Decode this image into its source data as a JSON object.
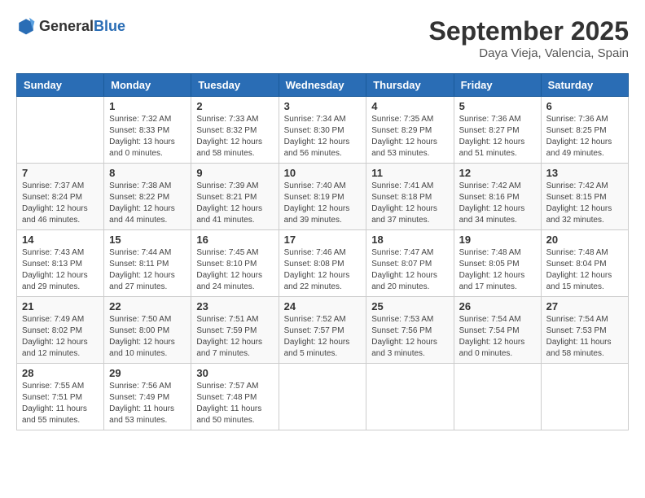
{
  "header": {
    "logo_general": "General",
    "logo_blue": "Blue",
    "month": "September 2025",
    "location": "Daya Vieja, Valencia, Spain"
  },
  "days_of_week": [
    "Sunday",
    "Monday",
    "Tuesday",
    "Wednesday",
    "Thursday",
    "Friday",
    "Saturday"
  ],
  "weeks": [
    [
      {
        "day": "",
        "sunrise": "",
        "sunset": "",
        "daylight": ""
      },
      {
        "day": "1",
        "sunrise": "Sunrise: 7:32 AM",
        "sunset": "Sunset: 8:33 PM",
        "daylight": "Daylight: 13 hours and 0 minutes."
      },
      {
        "day": "2",
        "sunrise": "Sunrise: 7:33 AM",
        "sunset": "Sunset: 8:32 PM",
        "daylight": "Daylight: 12 hours and 58 minutes."
      },
      {
        "day": "3",
        "sunrise": "Sunrise: 7:34 AM",
        "sunset": "Sunset: 8:30 PM",
        "daylight": "Daylight: 12 hours and 56 minutes."
      },
      {
        "day": "4",
        "sunrise": "Sunrise: 7:35 AM",
        "sunset": "Sunset: 8:29 PM",
        "daylight": "Daylight: 12 hours and 53 minutes."
      },
      {
        "day": "5",
        "sunrise": "Sunrise: 7:36 AM",
        "sunset": "Sunset: 8:27 PM",
        "daylight": "Daylight: 12 hours and 51 minutes."
      },
      {
        "day": "6",
        "sunrise": "Sunrise: 7:36 AM",
        "sunset": "Sunset: 8:25 PM",
        "daylight": "Daylight: 12 hours and 49 minutes."
      }
    ],
    [
      {
        "day": "7",
        "sunrise": "Sunrise: 7:37 AM",
        "sunset": "Sunset: 8:24 PM",
        "daylight": "Daylight: 12 hours and 46 minutes."
      },
      {
        "day": "8",
        "sunrise": "Sunrise: 7:38 AM",
        "sunset": "Sunset: 8:22 PM",
        "daylight": "Daylight: 12 hours and 44 minutes."
      },
      {
        "day": "9",
        "sunrise": "Sunrise: 7:39 AM",
        "sunset": "Sunset: 8:21 PM",
        "daylight": "Daylight: 12 hours and 41 minutes."
      },
      {
        "day": "10",
        "sunrise": "Sunrise: 7:40 AM",
        "sunset": "Sunset: 8:19 PM",
        "daylight": "Daylight: 12 hours and 39 minutes."
      },
      {
        "day": "11",
        "sunrise": "Sunrise: 7:41 AM",
        "sunset": "Sunset: 8:18 PM",
        "daylight": "Daylight: 12 hours and 37 minutes."
      },
      {
        "day": "12",
        "sunrise": "Sunrise: 7:42 AM",
        "sunset": "Sunset: 8:16 PM",
        "daylight": "Daylight: 12 hours and 34 minutes."
      },
      {
        "day": "13",
        "sunrise": "Sunrise: 7:42 AM",
        "sunset": "Sunset: 8:15 PM",
        "daylight": "Daylight: 12 hours and 32 minutes."
      }
    ],
    [
      {
        "day": "14",
        "sunrise": "Sunrise: 7:43 AM",
        "sunset": "Sunset: 8:13 PM",
        "daylight": "Daylight: 12 hours and 29 minutes."
      },
      {
        "day": "15",
        "sunrise": "Sunrise: 7:44 AM",
        "sunset": "Sunset: 8:11 PM",
        "daylight": "Daylight: 12 hours and 27 minutes."
      },
      {
        "day": "16",
        "sunrise": "Sunrise: 7:45 AM",
        "sunset": "Sunset: 8:10 PM",
        "daylight": "Daylight: 12 hours and 24 minutes."
      },
      {
        "day": "17",
        "sunrise": "Sunrise: 7:46 AM",
        "sunset": "Sunset: 8:08 PM",
        "daylight": "Daylight: 12 hours and 22 minutes."
      },
      {
        "day": "18",
        "sunrise": "Sunrise: 7:47 AM",
        "sunset": "Sunset: 8:07 PM",
        "daylight": "Daylight: 12 hours and 20 minutes."
      },
      {
        "day": "19",
        "sunrise": "Sunrise: 7:48 AM",
        "sunset": "Sunset: 8:05 PM",
        "daylight": "Daylight: 12 hours and 17 minutes."
      },
      {
        "day": "20",
        "sunrise": "Sunrise: 7:48 AM",
        "sunset": "Sunset: 8:04 PM",
        "daylight": "Daylight: 12 hours and 15 minutes."
      }
    ],
    [
      {
        "day": "21",
        "sunrise": "Sunrise: 7:49 AM",
        "sunset": "Sunset: 8:02 PM",
        "daylight": "Daylight: 12 hours and 12 minutes."
      },
      {
        "day": "22",
        "sunrise": "Sunrise: 7:50 AM",
        "sunset": "Sunset: 8:00 PM",
        "daylight": "Daylight: 12 hours and 10 minutes."
      },
      {
        "day": "23",
        "sunrise": "Sunrise: 7:51 AM",
        "sunset": "Sunset: 7:59 PM",
        "daylight": "Daylight: 12 hours and 7 minutes."
      },
      {
        "day": "24",
        "sunrise": "Sunrise: 7:52 AM",
        "sunset": "Sunset: 7:57 PM",
        "daylight": "Daylight: 12 hours and 5 minutes."
      },
      {
        "day": "25",
        "sunrise": "Sunrise: 7:53 AM",
        "sunset": "Sunset: 7:56 PM",
        "daylight": "Daylight: 12 hours and 3 minutes."
      },
      {
        "day": "26",
        "sunrise": "Sunrise: 7:54 AM",
        "sunset": "Sunset: 7:54 PM",
        "daylight": "Daylight: 12 hours and 0 minutes."
      },
      {
        "day": "27",
        "sunrise": "Sunrise: 7:54 AM",
        "sunset": "Sunset: 7:53 PM",
        "daylight": "Daylight: 11 hours and 58 minutes."
      }
    ],
    [
      {
        "day": "28",
        "sunrise": "Sunrise: 7:55 AM",
        "sunset": "Sunset: 7:51 PM",
        "daylight": "Daylight: 11 hours and 55 minutes."
      },
      {
        "day": "29",
        "sunrise": "Sunrise: 7:56 AM",
        "sunset": "Sunset: 7:49 PM",
        "daylight": "Daylight: 11 hours and 53 minutes."
      },
      {
        "day": "30",
        "sunrise": "Sunrise: 7:57 AM",
        "sunset": "Sunset: 7:48 PM",
        "daylight": "Daylight: 11 hours and 50 minutes."
      },
      {
        "day": "",
        "sunrise": "",
        "sunset": "",
        "daylight": ""
      },
      {
        "day": "",
        "sunrise": "",
        "sunset": "",
        "daylight": ""
      },
      {
        "day": "",
        "sunrise": "",
        "sunset": "",
        "daylight": ""
      },
      {
        "day": "",
        "sunrise": "",
        "sunset": "",
        "daylight": ""
      }
    ]
  ]
}
